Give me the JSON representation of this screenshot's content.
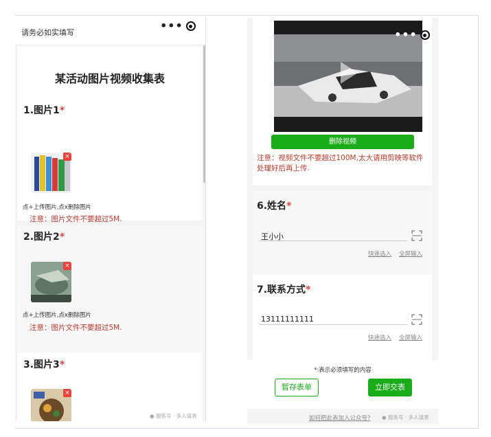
{
  "left_phone": {
    "header_text": "请务必如实填写",
    "form_title": "某活动图片视频收集表",
    "questions": [
      {
        "number_title": "1.图片1",
        "required_mark": "*",
        "upload_hint": "点+上传图片,点x删除图片",
        "note": "注意：图片文件不要超过5M."
      },
      {
        "number_title": "2.图片2",
        "required_mark": "*",
        "upload_hint": "点+上传图片,点x删除图片",
        "note": "注意：图片文件不要超过5M."
      },
      {
        "number_title": "3.图片3",
        "required_mark": "*"
      }
    ],
    "delete_glyph": "×",
    "watermark": "服务号 · 多人填表"
  },
  "right_phone": {
    "delete_video_label": "删除视频",
    "video_note": "注意：视频文件不要超过100M,太大请用剪映等软件处理好后再上传.",
    "name_question": {
      "title": "6.姓名",
      "required_mark": "*",
      "value": "王小小",
      "quick_select": "快速选入",
      "fullscreen_input": "全屏输入"
    },
    "contact_question": {
      "title": "7.联系方式",
      "required_mark": "*",
      "value": "13111111111",
      "quick_select": "快速选入",
      "fullscreen_input": "全屏输入"
    },
    "required_note": "*:表示必须填写的内容",
    "save_draft_label": "暂存表单",
    "submit_label": "立即交表",
    "footer_link": "如何把此表加入公众号?",
    "watermark": "服务号 · 多人填表"
  },
  "colors": {
    "accent_green": "#1aad19",
    "required_red": "#e8443a",
    "note_red": "#c0392b"
  },
  "icons": [
    "more-dots-icon",
    "close-target-icon",
    "delete-x-icon",
    "scan-icon",
    "wechat-icon"
  ]
}
